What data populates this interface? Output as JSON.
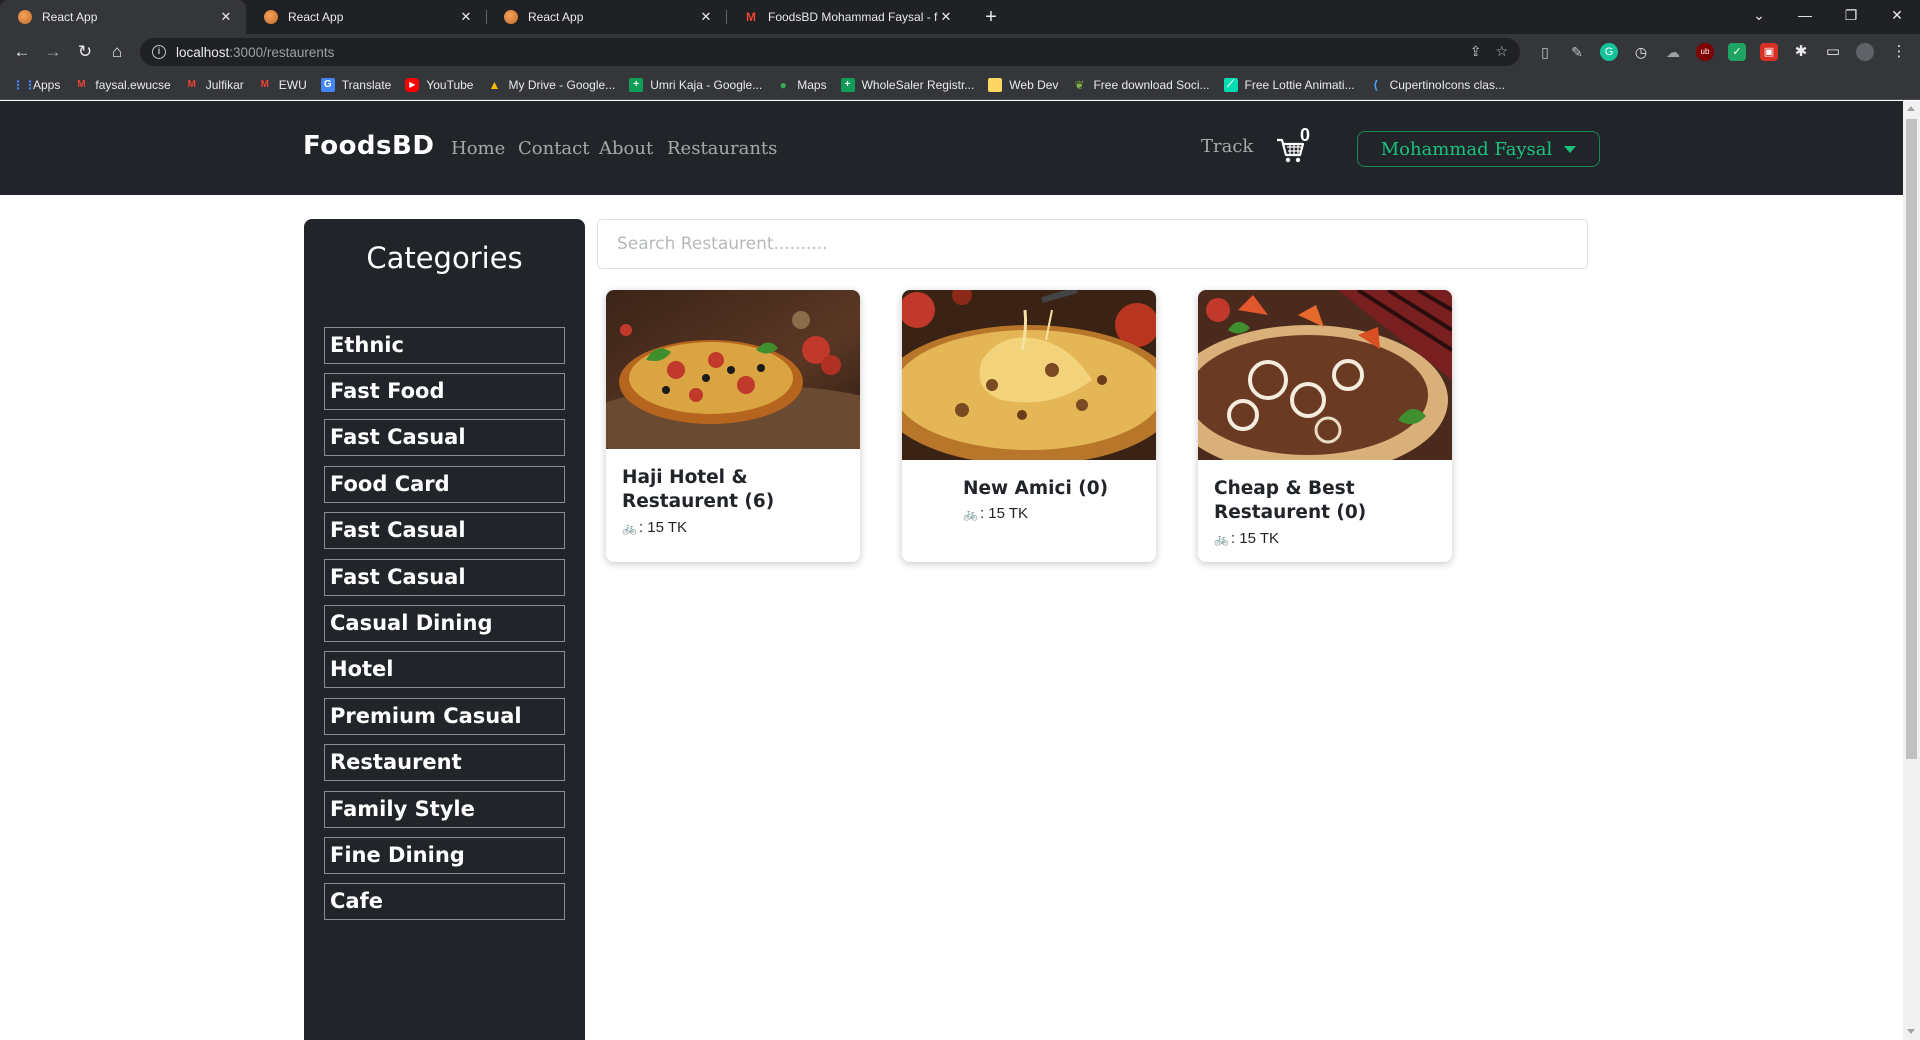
{
  "browser": {
    "tabs": [
      {
        "title": "React App",
        "active": true
      },
      {
        "title": "React App",
        "active": false
      },
      {
        "title": "React App",
        "active": false
      },
      {
        "title": "FoodsBD Mohammad Faysal - fa",
        "active": false
      }
    ],
    "url_host": "localhost",
    "url_path": ":3000/restaurents",
    "bookmarks": [
      "Apps",
      "faysal.ewucse",
      "Julfikar",
      "EWU",
      "Translate",
      "YouTube",
      "My Drive - Google...",
      "Umri Kaja - Google...",
      "Maps",
      "WholeSaler Registr...",
      "Web Dev",
      "Free download Soci...",
      "Free Lottie Animati...",
      "CupertinoIcons clas..."
    ]
  },
  "navbar": {
    "brand": "FoodsBD",
    "links": [
      "Home",
      "Contact",
      "About",
      "Restaurants"
    ],
    "track": "Track",
    "cart_count": "0",
    "user": "Mohammad Faysal"
  },
  "sidebar": {
    "title": "Categories",
    "categories": [
      "Ethnic",
      "Fast Food",
      "Fast Casual",
      "Food Card",
      "Fast Casual",
      "Fast Casual",
      "Casual Dining",
      "Hotel",
      "Premium Casual",
      "Restaurent",
      "Family Style",
      "Fine Dining",
      "Cafe"
    ]
  },
  "search": {
    "placeholder": "Search Restaurent..........",
    "value": ""
  },
  "restaurants": [
    {
      "name": "Haji Hotel & Restaurent (6)",
      "price": ": 15 TK",
      "image": "pizza-with-tomatoes-olives"
    },
    {
      "name": "New Amici (0)",
      "price": ": 15 TK",
      "image": "cheesy-pizza-slice"
    },
    {
      "name": "Cheap & Best Restaurent (0)",
      "price": ": 15 TK",
      "image": "kebab-with-onions"
    }
  ],
  "colors": {
    "navbar_bg": "#212529",
    "user_button_accent": "#19c37d",
    "sidebar_bg": "#212529"
  }
}
